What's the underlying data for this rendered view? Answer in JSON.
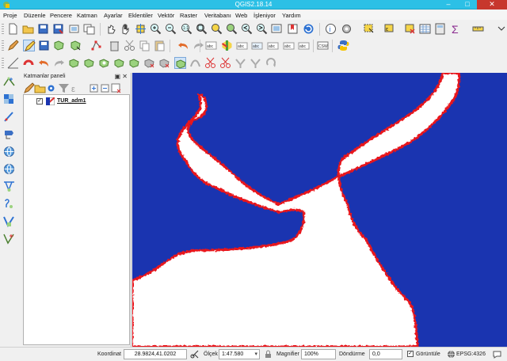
{
  "window": {
    "title": "QGIS2.18.14"
  },
  "menu": [
    "Proje",
    "Düzenle",
    "Pencere",
    "Katman",
    "Ayarlar",
    "Eklentiler",
    "Vektör",
    "Raster",
    "Veritabanı",
    "Web",
    "İşleniyor",
    "Yardım"
  ],
  "layers_panel": {
    "title": "Katmanlar paneli",
    "layers": [
      {
        "name": "TUR_adm1",
        "visible": true
      }
    ]
  },
  "status": {
    "coordinate_label": "Koordinat",
    "coordinate_value": "28.9824,41.0202",
    "scale_label": "Ölçek",
    "scale_value": "1:47.580",
    "magnifier_label": "Magnifier",
    "magnifier_value": "100%",
    "rotation_label": "Döndürme",
    "rotation_value": "0,0",
    "render_label": "Görüntüle",
    "render_checked": true,
    "crs": "EPSG:4326"
  },
  "colors": {
    "water": "#1a34b0",
    "land": "#ffffff",
    "outline": "#e8141b",
    "titlebar": "#2cc0e6"
  }
}
